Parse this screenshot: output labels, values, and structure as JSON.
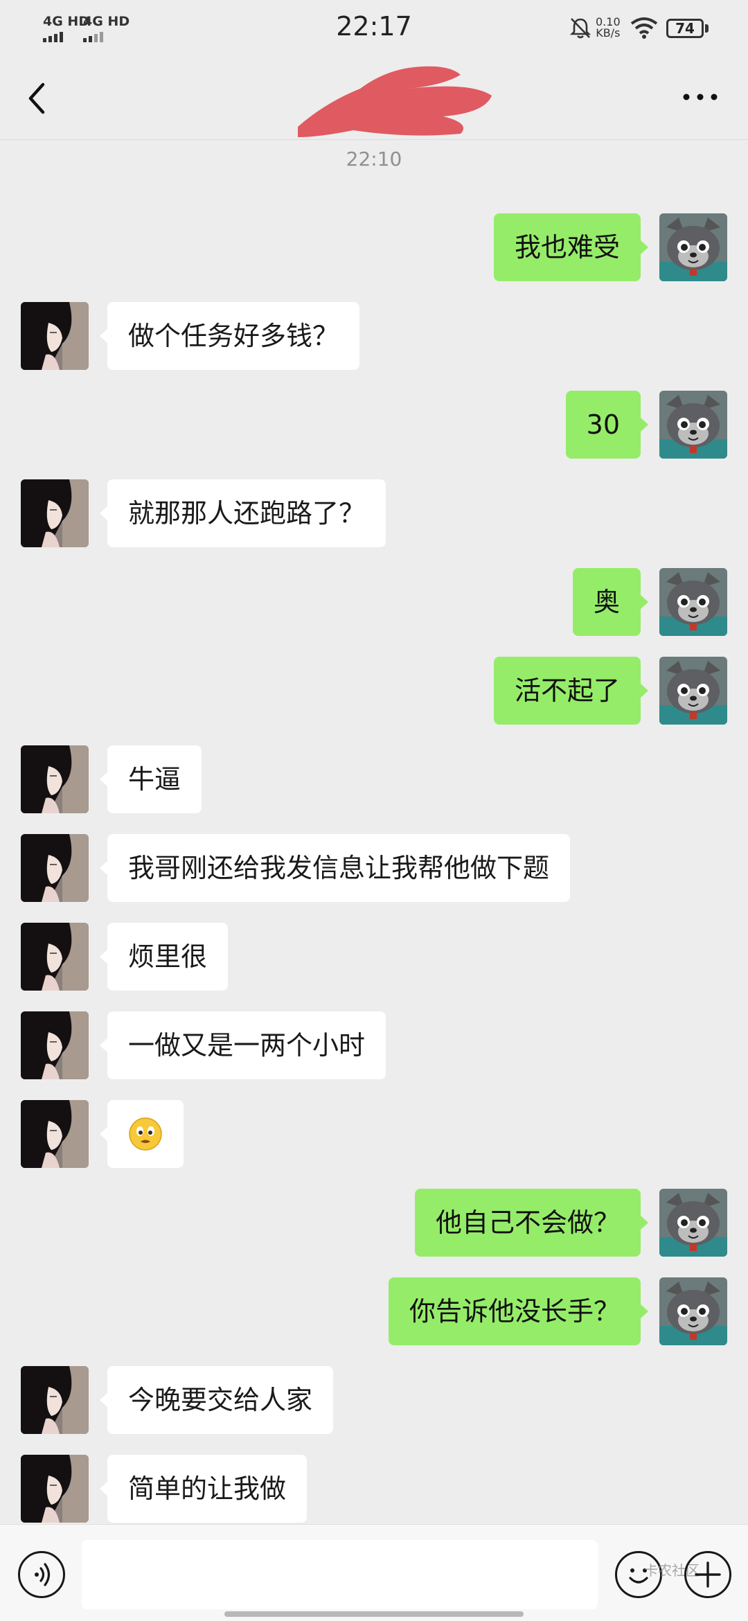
{
  "status_bar": {
    "signal_1": "4G HD",
    "signal_2": "4G HD",
    "time": "22:17",
    "net_speed_value": "0.10",
    "net_speed_unit": "KB/s",
    "battery": "74"
  },
  "nav": {
    "back_icon": "chevron-left-icon",
    "more_icon": "more-dots-icon",
    "title_redacted": true
  },
  "divider_time": "22:10",
  "messages": [
    {
      "side": "right",
      "text": "我也难受"
    },
    {
      "side": "left",
      "text": "做个任务好多钱？"
    },
    {
      "side": "right",
      "text": "30"
    },
    {
      "side": "left",
      "text": "就那那人还跑路了？"
    },
    {
      "side": "right",
      "text": "奥"
    },
    {
      "side": "right",
      "text": "活不起了"
    },
    {
      "side": "left",
      "text": "牛逼"
    },
    {
      "side": "left",
      "text": "我哥刚还给我发信息让我帮他做下题"
    },
    {
      "side": "left",
      "text": "烦里很"
    },
    {
      "side": "left",
      "text": "一做又是一两个小时"
    },
    {
      "side": "left",
      "emoji": "smirk-face-emoji"
    },
    {
      "side": "right",
      "text": "他自己不会做？"
    },
    {
      "side": "right",
      "text": "你告诉他没长手？"
    },
    {
      "side": "left",
      "text": "今晚要交给人家"
    },
    {
      "side": "left",
      "text": "简单的让我做"
    }
  ],
  "input_bar": {
    "voice_icon": "voice-icon",
    "emoji_icon": "emoji-icon",
    "plus_icon": "plus-icon",
    "watermark": "卡农社区"
  },
  "colors": {
    "background": "#ededed",
    "sent_bubble": "#95ec69",
    "received_bubble": "#ffffff",
    "redaction": "#e05a62"
  }
}
